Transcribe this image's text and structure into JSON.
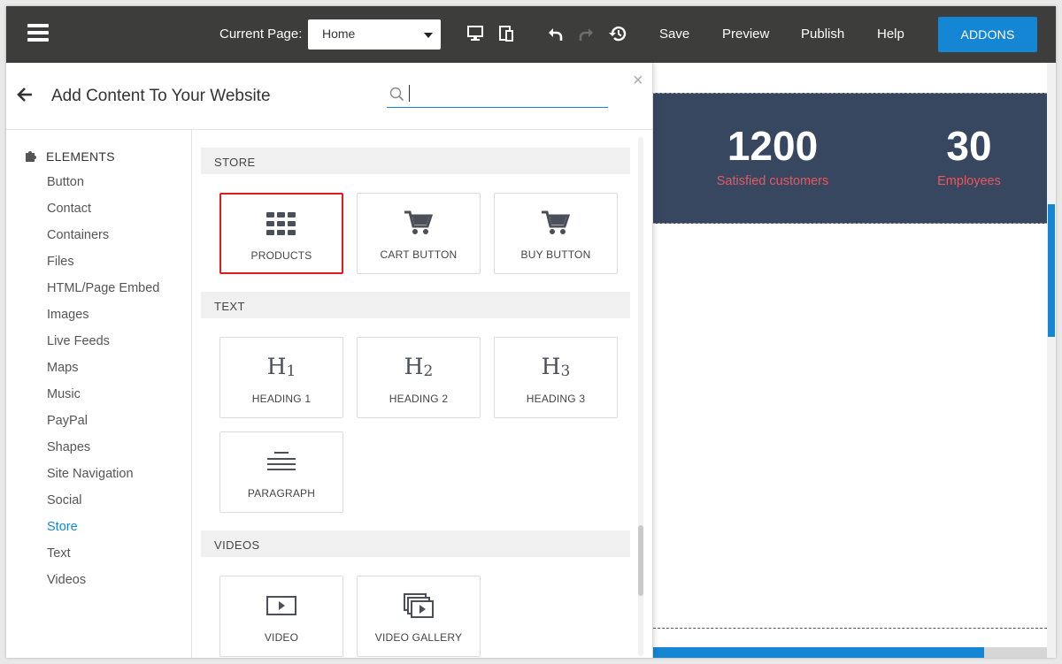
{
  "toolbar": {
    "current_page_label": "Current Page:",
    "current_page_value": "Home",
    "save": "Save",
    "preview": "Preview",
    "publish": "Publish",
    "help": "Help",
    "addons": "ADDONS",
    "icons": [
      "menu-icon",
      "desktop-icon",
      "tablet-icon",
      "undo-icon",
      "redo-icon",
      "history-icon"
    ]
  },
  "panel": {
    "title": "Add Content To Your Website",
    "search_value": "",
    "close": "×",
    "sidebar": {
      "header": "ELEMENTS",
      "items": [
        "Button",
        "Contact",
        "Containers",
        "Files",
        "HTML/Page Embed",
        "Images",
        "Live Feeds",
        "Maps",
        "Music",
        "PayPal",
        "Shapes",
        "Site Navigation",
        "Social",
        "Store",
        "Text",
        "Videos"
      ],
      "active": "Store"
    },
    "sections": [
      {
        "title": "STORE",
        "tiles": [
          "PRODUCTS",
          "CART BUTTON",
          "BUY BUTTON"
        ]
      },
      {
        "title": "TEXT",
        "tiles": [
          "HEADING 1",
          "HEADING 2",
          "HEADING 3",
          "PARAGRAPH"
        ]
      },
      {
        "title": "VIDEOS",
        "tiles": [
          "VIDEO",
          "VIDEO GALLERY"
        ]
      }
    ],
    "heading_glyphs": [
      {
        "h": "H",
        "n": "1"
      },
      {
        "h": "H",
        "n": "2"
      },
      {
        "h": "H",
        "n": "3"
      }
    ],
    "selected_tile": "PRODUCTS"
  },
  "preview": {
    "stats": [
      {
        "value": "1200",
        "label": "Satisfied customers"
      },
      {
        "value": "30",
        "label": "Employees"
      }
    ]
  },
  "colors": {
    "toolbar_bg": "#3d3d3b",
    "accent": "#1586d3",
    "selection": "#e11b1b",
    "stats_bg": "#374760",
    "stats_label": "#e8575e"
  }
}
